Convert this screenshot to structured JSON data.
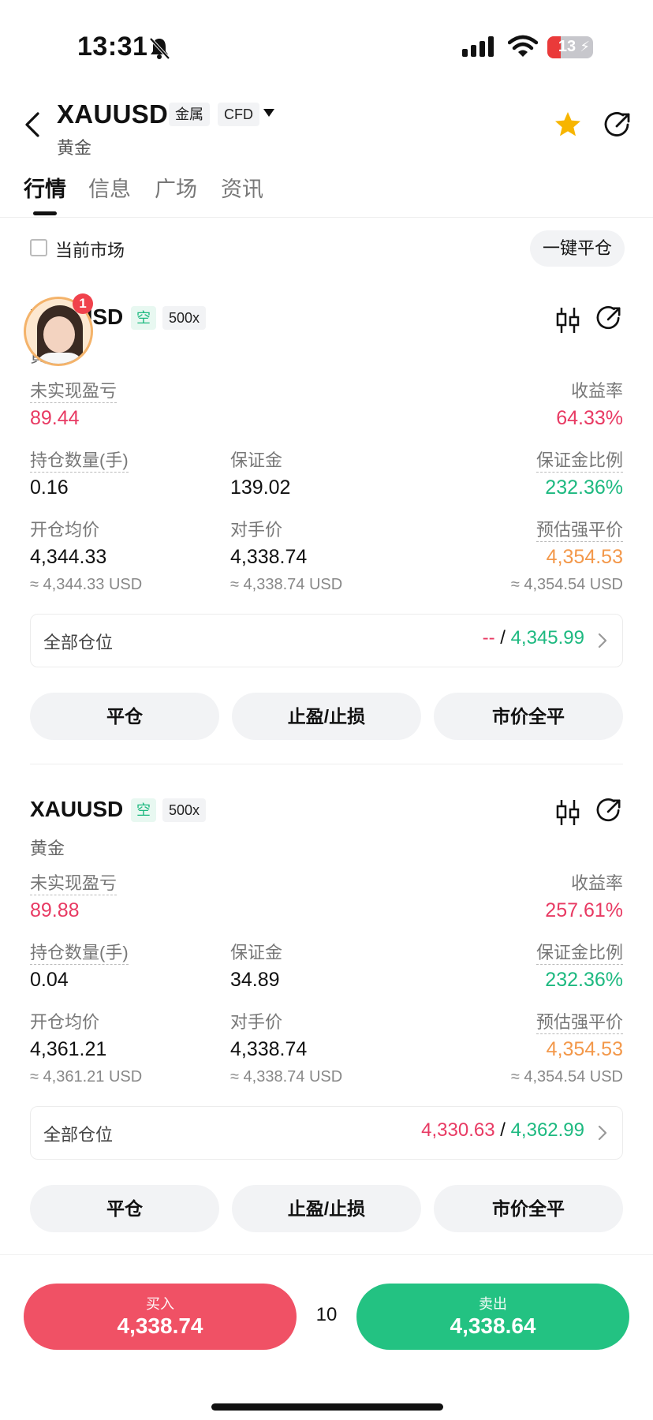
{
  "status_bar": {
    "time": "13:31",
    "battery": "13"
  },
  "header": {
    "symbol": "XAUUSD",
    "tag_metal": "金属",
    "tag_cfd": "CFD",
    "name": "黄金",
    "favorite_icon": "star-icon",
    "share_icon": "share-icon"
  },
  "tabs": [
    {
      "label": "行情"
    },
    {
      "label": "信息"
    },
    {
      "label": "广场"
    },
    {
      "label": "资讯"
    }
  ],
  "filter": {
    "current_market": "当前市场",
    "close_all": "一键平仓"
  },
  "avatar": {
    "badge": "1"
  },
  "labels": {
    "unrealized": "未实现盈亏",
    "yield": "收益率",
    "qty": "持仓数量(手)",
    "margin": "保证金",
    "margin_ratio": "保证金比例",
    "open_avg": "开仓均价",
    "counter_price": "对手价",
    "liq_price": "预估强平价",
    "all_positions": "全部仓位",
    "btn_close": "平仓",
    "btn_tpsl": "止盈/止损",
    "btn_market_close": "市价全平"
  },
  "positions": [
    {
      "symbol": "XAUUSD",
      "side": "空",
      "leverage": "500x",
      "name": "黄金",
      "unrealized": "89.44",
      "yield": "64.33%",
      "qty": "0.16",
      "margin": "139.02",
      "margin_ratio": "232.36%",
      "open_avg": "4,344.33",
      "open_avg_usd": "≈ 4,344.33 USD",
      "counter_price": "4,338.74",
      "counter_price_usd": "≈ 4,338.74 USD",
      "liq_price": "4,354.53",
      "liq_price_usd": "≈ 4,354.54 USD",
      "all_tp": "--",
      "all_sl": "4,345.99"
    },
    {
      "symbol": "XAUUSD",
      "side": "空",
      "leverage": "500x",
      "name": "黄金",
      "unrealized": "89.88",
      "yield": "257.61%",
      "qty": "0.04",
      "margin": "34.89",
      "margin_ratio": "232.36%",
      "open_avg": "4,361.21",
      "open_avg_usd": "≈ 4,361.21 USD",
      "counter_price": "4,338.74",
      "counter_price_usd": "≈ 4,338.74 USD",
      "liq_price": "4,354.53",
      "liq_price_usd": "≈ 4,354.54 USD",
      "all_tp": "4,330.63",
      "all_sl": "4,362.99"
    }
  ],
  "trade_bar": {
    "buy_label": "买入",
    "buy_price": "4,338.74",
    "quantity": "10",
    "sell_label": "卖出",
    "sell_price": "4,338.64"
  },
  "colors": {
    "profit_red": "#e83a63",
    "ratio_green": "#1db980",
    "liq_orange": "#f3984a",
    "buy": "#f05165",
    "sell": "#23c282"
  }
}
